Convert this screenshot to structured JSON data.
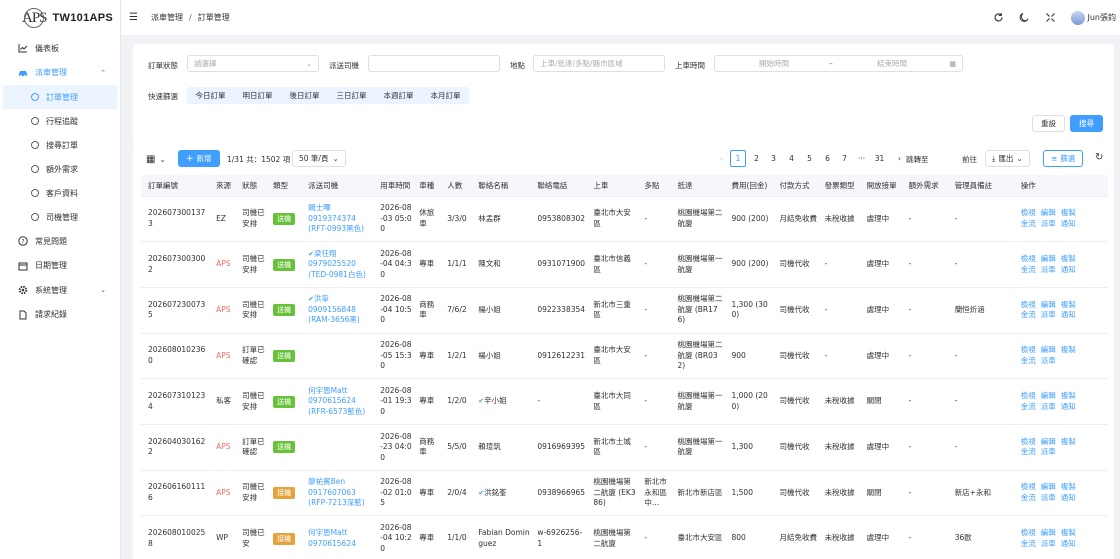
{
  "brand": {
    "mark": "APS",
    "name": "TW101APS"
  },
  "sidebar": {
    "items": [
      {
        "label": "儀表板",
        "icon": "chart-line-icon"
      },
      {
        "label": "派車管理",
        "icon": "car-icon",
        "expanded": true
      },
      {
        "label": "常見問題",
        "icon": "question-circle-icon"
      },
      {
        "label": "日期管理",
        "icon": "calendar-icon"
      },
      {
        "label": "系統管理",
        "icon": "gear-icon"
      },
      {
        "label": "請求紀錄",
        "icon": "document-icon"
      }
    ],
    "subitems": [
      "訂單管理",
      "行程追蹤",
      "搜尋訂單",
      "額外需求",
      "客戶資料",
      "司機管理"
    ]
  },
  "header": {
    "breadcrumb": [
      "派車管理",
      "訂單管理"
    ],
    "user": "Jun張鈞"
  },
  "filters": {
    "status_label": "訂單狀態",
    "status_placeholder": "請選擇",
    "driver_label": "派送司機",
    "driver_value": "",
    "address_label": "地點",
    "address_placeholder": "上車/抵達/多點/縣市區域",
    "time_label": "上車時間",
    "start_placeholder": "開始時間",
    "range_sep": "–",
    "end_placeholder": "結束時間",
    "quick_label": "快速篩選",
    "quick": [
      "今日訂單",
      "明日訂單",
      "後日訂單",
      "三日訂單",
      "本週訂單",
      "本月訂單"
    ],
    "reset": "重設",
    "search": "搜尋"
  },
  "toolbar": {
    "new": "新增",
    "summary": "1/31 共：1502 項",
    "page_size": "50 筆/頁",
    "pages": [
      "1",
      "2",
      "3",
      "4",
      "5",
      "6",
      "7",
      "···",
      "31"
    ],
    "current_page": "1",
    "jump_label": "跳轉至",
    "go": "前往",
    "export": "匯出",
    "filter": "篩選"
  },
  "table": {
    "headers": [
      "訂單編號",
      "來源",
      "狀態",
      "類型",
      "派送司機",
      "用車時間",
      "車種",
      "人數",
      "聯絡名稱",
      "聯絡電話",
      "上車",
      "多點",
      "抵達",
      "費用(回金)",
      "付款方式",
      "發票類型",
      "開放接單",
      "額外需求",
      "管理員備註",
      "操作"
    ],
    "rows": [
      {
        "id": "2026073001373",
        "source": "EZ",
        "status": "司機已安排",
        "type": "送機",
        "type_color": "green",
        "driver": [
          "闕士暉",
          "0919374374",
          "(RFT-0993黑色)"
        ],
        "driver_check": false,
        "time": "2026-08-03 05:00",
        "car": "休旅車",
        "pax": "3/3/0",
        "contact": "林孟群",
        "contact_check": false,
        "phone": "0953808302",
        "pickup": "臺北市大安區",
        "multi": "-",
        "dropoff": "桃園機場第二航廈",
        "fee": "900 (200)",
        "pay": "月結免收費",
        "invoice": "未稅收據",
        "open": "處理中",
        "extra": "-",
        "note": "-",
        "ops": [
          "檢視",
          "編輯",
          "複製",
          "金流",
          "派車",
          "通知"
        ]
      },
      {
        "id": "2026073003002",
        "source": "APS",
        "status": "司機已安排",
        "type": "送機",
        "type_color": "green",
        "driver": [
          "梁任翔",
          "0979025520",
          "(TED-0981白色)"
        ],
        "driver_check": true,
        "time": "2026-08-04 04:30",
        "car": "專車",
        "pax": "1/1/1",
        "contact": "陳文和",
        "contact_check": false,
        "phone": "0931071900",
        "pickup": "臺北市信義區",
        "multi": "-",
        "dropoff": "桃園機場第一航廈",
        "fee": "900 (200)",
        "pay": "司機代收",
        "invoice": "-",
        "open": "處理中",
        "extra": "-",
        "note": "-",
        "ops": [
          "檢視",
          "編輯",
          "複製",
          "金流",
          "派車",
          "通知"
        ]
      },
      {
        "id": "2026072300735",
        "source": "APS",
        "status": "司機已安排",
        "type": "送機",
        "type_color": "green",
        "driver": [
          "洪寧",
          "0909156848",
          "(RAM-3656黑)"
        ],
        "driver_check": true,
        "time": "2026-08-04 10:50",
        "car": "商務車",
        "pax": "7/6/2",
        "contact": "楊小姐",
        "contact_check": false,
        "phone": "0922338354",
        "pickup": "新北市三重區",
        "multi": "-",
        "dropoff": "桃園機場第二航廈 (BR176)",
        "fee": "1,300 (300)",
        "pay": "司機代收",
        "invoice": "-",
        "open": "處理中",
        "extra": "-",
        "note": "蘭恒炘涵",
        "ops": [
          "檢視",
          "編輯",
          "複製",
          "金流",
          "派車",
          "通知"
        ]
      },
      {
        "id": "2026080102360",
        "source": "APS",
        "status": "訂單已確認",
        "type": "送機",
        "type_color": "green",
        "driver": [],
        "driver_check": false,
        "time": "2026-08-05 15:30",
        "car": "專車",
        "pax": "1/2/1",
        "contact": "楊小姐",
        "contact_check": false,
        "phone": "0912612231",
        "pickup": "臺北市大安區",
        "multi": "-",
        "dropoff": "桃園機場第二航廈 (BR032)",
        "fee": "900",
        "pay": "司機代收",
        "invoice": "-",
        "open": "處理中",
        "extra": "-",
        "note": "-",
        "ops": [
          "檢視",
          "編輯",
          "複製",
          "金流",
          "派車"
        ]
      },
      {
        "id": "2026073101234",
        "source": "私客",
        "status": "司機已安排",
        "type": "送機",
        "type_color": "green",
        "driver": [
          "何宇恩Matt",
          "0970615624",
          "(RFR-6573藍色)"
        ],
        "driver_check": false,
        "time": "2026-08-01 19:30",
        "car": "專車",
        "pax": "1/2/0",
        "contact": "辛小姐",
        "contact_check": true,
        "phone": "-",
        "pickup": "臺北市大同區",
        "multi": "-",
        "dropoff": "桃園機場第一航廈",
        "fee": "1,000 (200)",
        "pay": "司機代收",
        "invoice": "未稅收據",
        "open": "關閉",
        "extra": "-",
        "note": "-",
        "ops": [
          "檢視",
          "編輯",
          "複製",
          "金流",
          "派車",
          "通知"
        ]
      },
      {
        "id": "2026040301622",
        "source": "APS",
        "status": "訂單已確認",
        "type": "送機",
        "type_color": "green",
        "driver": [],
        "driver_check": false,
        "time": "2026-08-23 04:00",
        "car": "商務車",
        "pax": "5/5/0",
        "contact": "賴瑄筑",
        "contact_check": false,
        "phone": "0916969395",
        "pickup": "新北市土城區",
        "multi": "-",
        "dropoff": "桃園機場第一航廈",
        "fee": "1,300",
        "pay": "司機代收",
        "invoice": "未稅收據",
        "open": "處理中",
        "extra": "-",
        "note": "-",
        "ops": [
          "檢視",
          "編輯",
          "複製",
          "金流",
          "派車"
        ]
      },
      {
        "id": "2026061601116",
        "source": "APS",
        "status": "司機已安排",
        "type": "接機",
        "type_color": "orange",
        "driver": [
          "廖祐賓Ben",
          "0917607063",
          "(RFP-7213深藍)"
        ],
        "driver_check": false,
        "time": "2026-08-02 01:05",
        "car": "專車",
        "pax": "2/0/4",
        "contact": "洪銘峯",
        "contact_check": true,
        "phone": "0938966965",
        "pickup": "桃園機場第二航廈 (EK386)",
        "multi": "新北市永和區中...",
        "dropoff": "新北市新店區",
        "fee": "1,500",
        "pay": "司機代收",
        "invoice": "未稅收據",
        "open": "關閉",
        "extra": "-",
        "note": "新店+永和",
        "ops": [
          "檢視",
          "編輯",
          "複製",
          "金流",
          "派車",
          "通知"
        ]
      },
      {
        "id": "2026080100258",
        "source": "WP",
        "status": "司機已安",
        "type": "接機",
        "type_color": "orange",
        "driver": [
          "何宇恩Matt",
          "0970615624"
        ],
        "driver_check": false,
        "time": "2026-08-04 10:20",
        "car": "專車",
        "pax": "1/1/0",
        "contact": "Fabian Dominguez",
        "contact_check": false,
        "phone": "w-6926256-1",
        "pickup": "桃園機場第二航廈",
        "multi": "-",
        "dropoff": "臺北市大安區",
        "fee": "800",
        "pay": "月結免收費",
        "invoice": "未稅收據",
        "open": "處理中",
        "extra": "-",
        "note": "36歐",
        "ops": [
          "檢視",
          "編輯",
          "複製",
          "金流",
          "派車",
          "通知"
        ]
      }
    ]
  },
  "colors": {
    "primary": "#409eff",
    "green": "#67c23a",
    "orange": "#e6a23c",
    "danger": "#f56c6c"
  }
}
